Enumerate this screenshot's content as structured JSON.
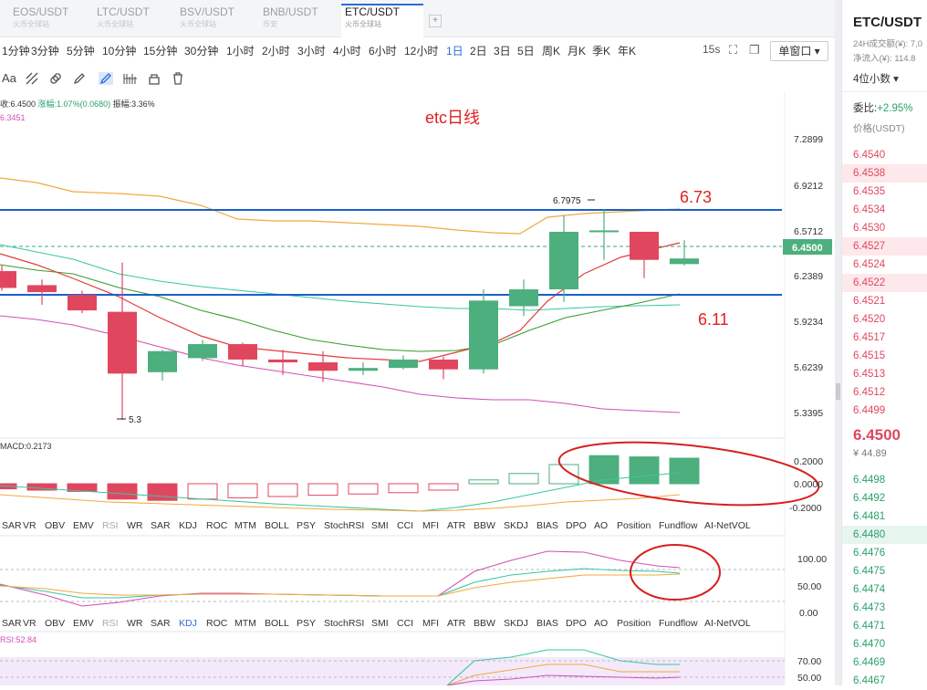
{
  "tabs": [
    {
      "label": "EOS/USDT",
      "sub": "火币全球站",
      "active": false
    },
    {
      "label": "LTC/USDT",
      "sub": "火币全球站",
      "active": false
    },
    {
      "label": "BSV/USDT",
      "sub": "火币全球站",
      "active": false
    },
    {
      "label": "BNB/USDT",
      "sub": "币安",
      "active": false
    },
    {
      "label": "ETC/USDT",
      "sub": "火币全球站",
      "active": true
    }
  ],
  "tab_add": "+",
  "intervals": [
    "1分钟",
    "3分钟",
    "5分钟",
    "10分钟",
    "15分钟",
    "30分钟",
    "1小时",
    "2小时",
    "3小时",
    "4小时",
    "6小时",
    "12小时",
    "1日",
    "2日",
    "3日",
    "5日",
    "周K",
    "月K",
    "季K",
    "年K"
  ],
  "active_interval": "1日",
  "toolbar": {
    "rate": "15s",
    "window_label": "单窗口 ▾",
    "font_label": "Aa"
  },
  "info_line": {
    "price": "收:6.4500",
    "change": "涨幅:1.07%(0.0680)",
    "amplitude": "振幅:3.36%"
  },
  "info_line2": "6.3451",
  "annotation_title": "etc日线",
  "annotation_high": "6.73",
  "annotation_low": "6.11",
  "high_marker": "6.7975",
  "low_marker": "5.3",
  "current_price": "6.4500",
  "price_axis": [
    "7.2899",
    "6.9212",
    "6.5712",
    "6.2389",
    "5.9234",
    "5.6239",
    "5.3395"
  ],
  "macd": {
    "label": "MACD:0.2173",
    "axis": [
      "0.2000",
      "0.0000",
      "-0.2000"
    ]
  },
  "indicator_tabs": [
    "SAR",
    "VR",
    "OBV",
    "EMV",
    "RSI",
    "WR",
    "SAR",
    "KDJ",
    "ROC",
    "MTM",
    "BOLL",
    "PSY",
    "StochRSI",
    "SMI",
    "CCI",
    "MFI",
    "ATR",
    "BBW",
    "SKDJ",
    "BIAS",
    "DPO",
    "AO",
    "Position",
    "Fundflow",
    "AI-NetVOL"
  ],
  "indicator_tabs_active": "KDJ",
  "kdj_axis": [
    "100.00",
    "50.00",
    "0.00"
  ],
  "rsi": {
    "label": "RSI:52.84",
    "axis": [
      "70.00",
      "50.00"
    ]
  },
  "right_panel": {
    "symbol": "ETC/USDT",
    "volume_24h": "24H成交额(¥): 7,0",
    "net_inflow": "净流入(¥): 114.8",
    "precision": "4位小数 ▾",
    "ratio_label": "委比:",
    "ratio_value": "+2.95%",
    "price_header": "价格(USDT)",
    "asks": [
      "6.4540",
      "6.4538",
      "6.4535",
      "6.4534",
      "6.4530",
      "6.4527",
      "6.4524",
      "6.4522",
      "6.4521",
      "6.4520",
      "6.4517",
      "6.4515",
      "6.4513",
      "6.4512",
      "6.4499"
    ],
    "last_price": "6.4500",
    "last_cny": "¥ 44.89",
    "bids": [
      "6.4498",
      "6.4492",
      "6.4481",
      "6.4480",
      "6.4476",
      "6.4475",
      "6.4474",
      "6.4473",
      "6.4471",
      "6.4470",
      "6.4469",
      "6.4467"
    ]
  },
  "colors": {
    "up": "#4caf7d",
    "down": "#e0475f",
    "accent": "#2b6cd8",
    "annotation": "#e02020"
  },
  "candles": [
    {
      "o": 6.36,
      "h": 6.4,
      "l": 6.22,
      "c": 6.24
    },
    {
      "o": 6.26,
      "h": 6.3,
      "l": 6.12,
      "c": 6.21
    },
    {
      "o": 6.19,
      "h": 6.22,
      "l": 6.06,
      "c": 6.08
    },
    {
      "o": 6.07,
      "h": 6.42,
      "l": 5.3,
      "c": 5.63
    },
    {
      "o": 5.64,
      "h": 5.8,
      "l": 5.58,
      "c": 5.79
    },
    {
      "o": 5.74,
      "h": 5.87,
      "l": 5.72,
      "c": 5.84
    },
    {
      "o": 5.84,
      "h": 5.85,
      "l": 5.68,
      "c": 5.73
    },
    {
      "o": 5.73,
      "h": 5.8,
      "l": 5.62,
      "c": 5.71
    },
    {
      "o": 5.71,
      "h": 5.79,
      "l": 5.57,
      "c": 5.65
    },
    {
      "o": 5.65,
      "h": 5.71,
      "l": 5.62,
      "c": 5.67
    },
    {
      "o": 5.67,
      "h": 5.76,
      "l": 5.66,
      "c": 5.73
    },
    {
      "o": 5.73,
      "h": 5.75,
      "l": 5.59,
      "c": 5.66
    },
    {
      "o": 5.66,
      "h": 6.23,
      "l": 5.63,
      "c": 6.15
    },
    {
      "o": 6.11,
      "h": 6.3,
      "l": 6.04,
      "c": 6.23
    },
    {
      "o": 6.23,
      "h": 6.76,
      "l": 6.14,
      "c": 6.64
    },
    {
      "o": 6.64,
      "h": 6.8,
      "l": 6.44,
      "c": 6.65
    },
    {
      "o": 6.64,
      "h": 6.64,
      "l": 6.31,
      "c": 6.44
    },
    {
      "o": 6.41,
      "h": 6.58,
      "l": 6.4,
      "c": 6.45
    }
  ],
  "macd_bars": [
    -0.04,
    -0.05,
    -0.06,
    -0.12,
    -0.13,
    -0.12,
    -0.11,
    -0.1,
    -0.09,
    -0.08,
    -0.07,
    -0.05,
    0.03,
    0.08,
    0.15,
    0.22,
    0.21,
    0.2
  ]
}
